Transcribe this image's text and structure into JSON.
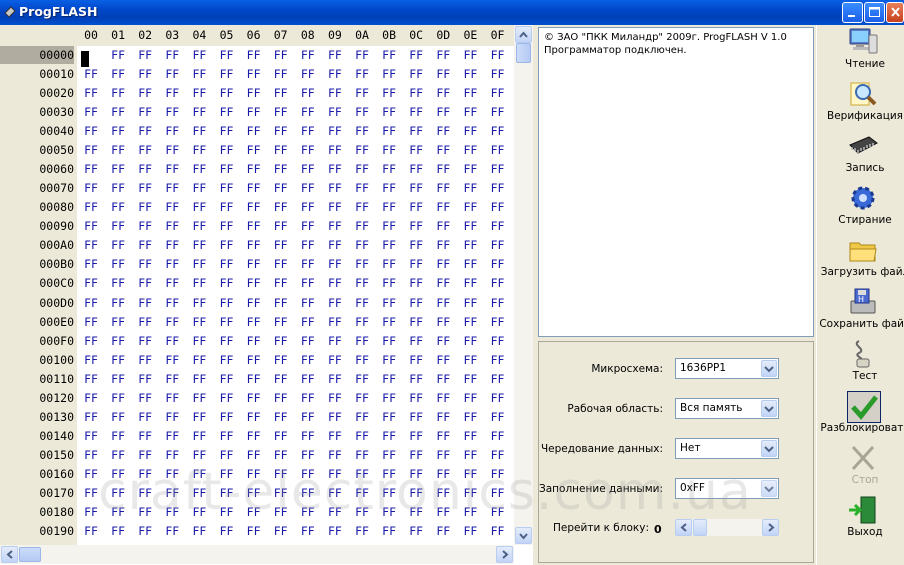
{
  "window": {
    "title": "ProgFLASH",
    "buttons": [
      "minimize",
      "maximize",
      "close"
    ]
  },
  "hex": {
    "columns": [
      "00",
      "01",
      "02",
      "03",
      "04",
      "05",
      "06",
      "07",
      "08",
      "09",
      "0A",
      "0B",
      "0C",
      "0D",
      "0E",
      "0F"
    ],
    "addresses": [
      "00000",
      "00010",
      "00020",
      "00030",
      "00040",
      "00050",
      "00060",
      "00070",
      "00080",
      "00090",
      "000A0",
      "000B0",
      "000C0",
      "000D0",
      "000E0",
      "000F0",
      "00100",
      "00110",
      "00120",
      "00130",
      "00140",
      "00150",
      "00160",
      "00170",
      "00180",
      "00190"
    ],
    "fill_value": "FF",
    "selected_address": "00000",
    "cursor_column": "00"
  },
  "log": {
    "lines": [
      "© ЗАО \"ПКК Миландр\" 2009г. ProgFLASH V 1.0",
      "Программатор подключен."
    ]
  },
  "settings": {
    "chip_label": "Микросхема:",
    "chip_value": "1636PP1",
    "area_label": "Рабочая область:",
    "area_value": "Вся память",
    "interleave_label": "Чередование данных:",
    "interleave_value": "Нет",
    "fill_label": "Заполнение данными:",
    "fill_value": "0xFF",
    "goto_label": "Перейти к блоку:",
    "goto_value": "0"
  },
  "toolbar": {
    "read": "Чтение",
    "verify": "Верификация",
    "write": "Запись",
    "erase": "Стирание",
    "load": "Загрузить файл",
    "save": "Сохранить файл",
    "test": "Тест",
    "unlock": "Разблокировать",
    "stop": "Стоп",
    "exit": "Выход"
  },
  "watermark": "craft-electronics.com.ua",
  "colors": {
    "titlebar": "#0047c8",
    "hex_value": "#1a1aa8",
    "window_bg": "#ece9d8"
  }
}
